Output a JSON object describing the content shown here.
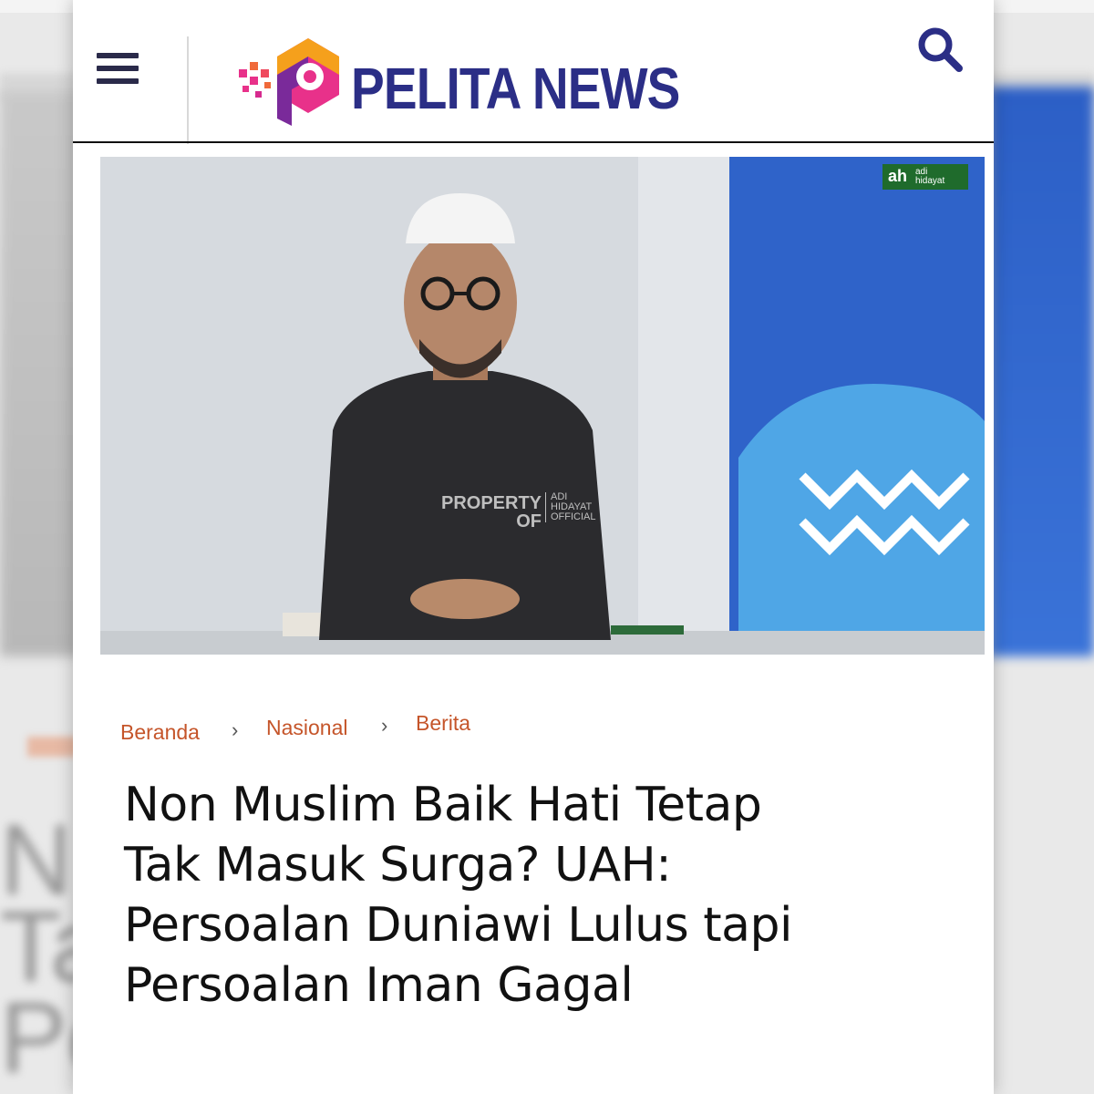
{
  "header": {
    "logo_text": "PELITA NEWS",
    "menu_icon": "hamburger-menu-icon",
    "search_icon": "search-icon",
    "brand_color": "#2b2e86",
    "accent_color": "#e8318a"
  },
  "hero": {
    "watermark_property": "PROPERTY",
    "watermark_of": "OF",
    "watermark_owner_line1": "ADI",
    "watermark_owner_line2": "HIDAYAT",
    "watermark_owner_line3": "OFFICIAL",
    "channel_logo_mark": "ah",
    "channel_logo_line1": "adi",
    "channel_logo_line2": "hidayat"
  },
  "breadcrumb": {
    "items": [
      "Beranda",
      "Nasional",
      "Berita"
    ],
    "separator": "›",
    "color": "#c5552a"
  },
  "article": {
    "title_lines": [
      "Non Muslim Baik Hati Tetap",
      "Tak Masuk Surga? UAH:",
      "Persoalan Duniawi Lulus tapi",
      "Persoalan Iman Gagal"
    ]
  }
}
